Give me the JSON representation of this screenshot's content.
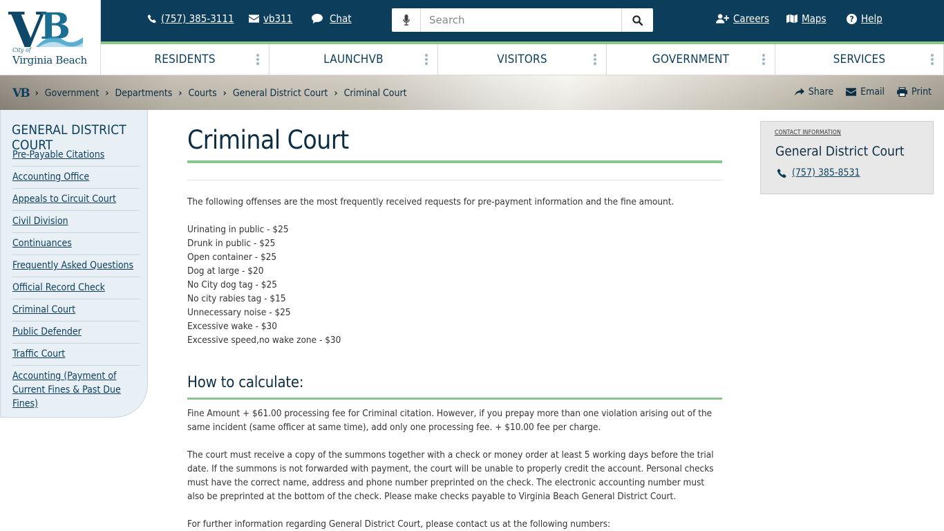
{
  "logo": {
    "city_of": "City of",
    "name": "Virginia Beach",
    "monogram": "VB"
  },
  "topbar": {
    "phone": "(757) 385-3111",
    "email": "vb311",
    "chat": "Chat",
    "search_placeholder": "Search",
    "careers": "Careers",
    "maps": "Maps",
    "help": "Help"
  },
  "nav": [
    "RESIDENTS",
    "LAUNCHVB",
    "VISITORS",
    "GOVERNMENT",
    "SERVICES"
  ],
  "breadcrumb": [
    "Government",
    "Departments",
    "Courts",
    "General District Court",
    "Criminal Court"
  ],
  "tools": {
    "share": "Share",
    "email": "Email",
    "print": "Print"
  },
  "sidebar": {
    "title": "GENERAL DISTRICT COURT",
    "items": [
      "Pre-Payable Citations",
      "Accounting Office",
      "Appeals to Circuit Court",
      "Civil Division",
      "Continuances",
      "Frequently Asked Questions",
      "Official Record Check",
      "Criminal Court",
      "Public Defender",
      "Traffic Court",
      "Accounting (Payment of Current Fines & Past Due Fines)"
    ]
  },
  "main": {
    "title": "Criminal Court",
    "intro": "The following offenses are the most frequently received requests for pre-payment information and the fine amount.",
    "offenses": [
      "Urinating in public - $25",
      "Drunk in public - $25",
      "Open container - $25",
      "Dog at large - $20",
      "No City dog tag - $25",
      "No city rabies tag - $15",
      "Unnecessary noise - $25",
      "Excessive wake - $30",
      "Excessive speed,no wake zone - $30"
    ],
    "heading2": "How to calculate:",
    "calc_text": "Fine Amount + $61.00 processing fee for Criminal citation. However, if you prepay more than one violation arising out of the same incident (same officer at same time), add only one processing fee. + $10.00 fee per charge.",
    "court_text": "The court must receive a copy of the summons together with a check or money order at least 5 working days before the trial date. If the summons is not forwarded with payment, the court will be unable to properly credit the account. Personal checks must have the correct name, address and phone number preprinted on the check. The electronic accounting number must also be preprinted at the bottom of the check. Please make checks payable to Virginia Beach General District Court.",
    "further_text": "For further information regarding General District Court, please contact us at the following numbers:"
  },
  "contact": {
    "label": "CONTACT INFORMATION",
    "name": "General District Court",
    "phone": "(757) 385-8531"
  },
  "colors": {
    "navy": "#0c3e5c",
    "accent_green": "#8dc68d",
    "sidebar_bg": "#e8f0f6"
  }
}
